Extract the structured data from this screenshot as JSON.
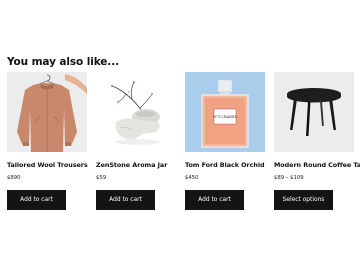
{
  "section": {
    "title": "You may also like..."
  },
  "products": [
    {
      "image_subject": "salmon-jacket",
      "name": "Tailored Wool Trousers",
      "price": "$890",
      "button_label": "Add to cart"
    },
    {
      "image_subject": "stone-jar-with-branch",
      "name": "ZenStone Aroma Jar",
      "price": "$59",
      "button_label": "Add to cart"
    },
    {
      "image_subject": "perfume-bottle",
      "name": "Tom Ford Black Orchid",
      "price": "$450",
      "image_label": "N°5 CHANEL",
      "button_label": "Add to cart"
    },
    {
      "image_subject": "round-black-coffee-table",
      "name": "Modern Round Coffee Table",
      "price": "$89 – $109",
      "button_label": "Select options"
    }
  ],
  "colors": {
    "button_bg": "#141414",
    "button_text": "#ffffff",
    "jacket": "#c9876b",
    "perfume_bg": "#a9cdea",
    "perfume_liquid": "#f1a282"
  }
}
